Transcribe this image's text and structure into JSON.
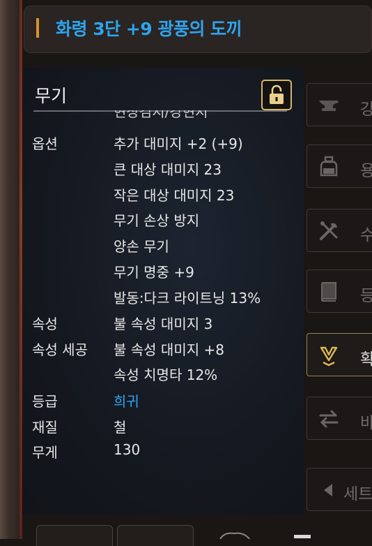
{
  "title": "화령 3단 +9 광풍의 도끼",
  "category": "무기",
  "clipped_text": "현장검지/강현지",
  "stats": {
    "option_label": "옵션",
    "options": [
      "추가 대미지 +2 (+9)",
      "큰 대상 대미지 23",
      "작은 대상 대미지 23",
      "무기 손상 방지",
      "양손 무기",
      "무기 명중 +9",
      "발동:다크 라이트닝 13%"
    ],
    "attribute_label": "속성",
    "attribute_value": "불 속성 대미지  3",
    "attr_craft_label": "속성 세공",
    "attr_craft_values": [
      "불 속성 대미지 +8",
      "속성 치명타 12%"
    ],
    "grade_label": "등급",
    "grade_value": "희귀",
    "material_label": "재질",
    "material_value": "철",
    "weight_label": "무게",
    "weight_value": "130"
  },
  "side_buttons": [
    {
      "label": "강",
      "icon": "anvil-icon"
    },
    {
      "label": "용",
      "icon": "potion-icon"
    },
    {
      "label": "수",
      "icon": "repair-tools-icon"
    },
    {
      "label": "등",
      "icon": "book-icon"
    },
    {
      "label": "확",
      "icon": "awaken-icon"
    },
    {
      "label": "바",
      "icon": "swap-icon"
    },
    {
      "label": "세트",
      "icon": "triangle-left-icon"
    }
  ],
  "colors": {
    "title": "#2ea4ee",
    "rarity": "#2ea4ee",
    "text": "#e8e8e8",
    "accent_gold": "#d9b860"
  }
}
